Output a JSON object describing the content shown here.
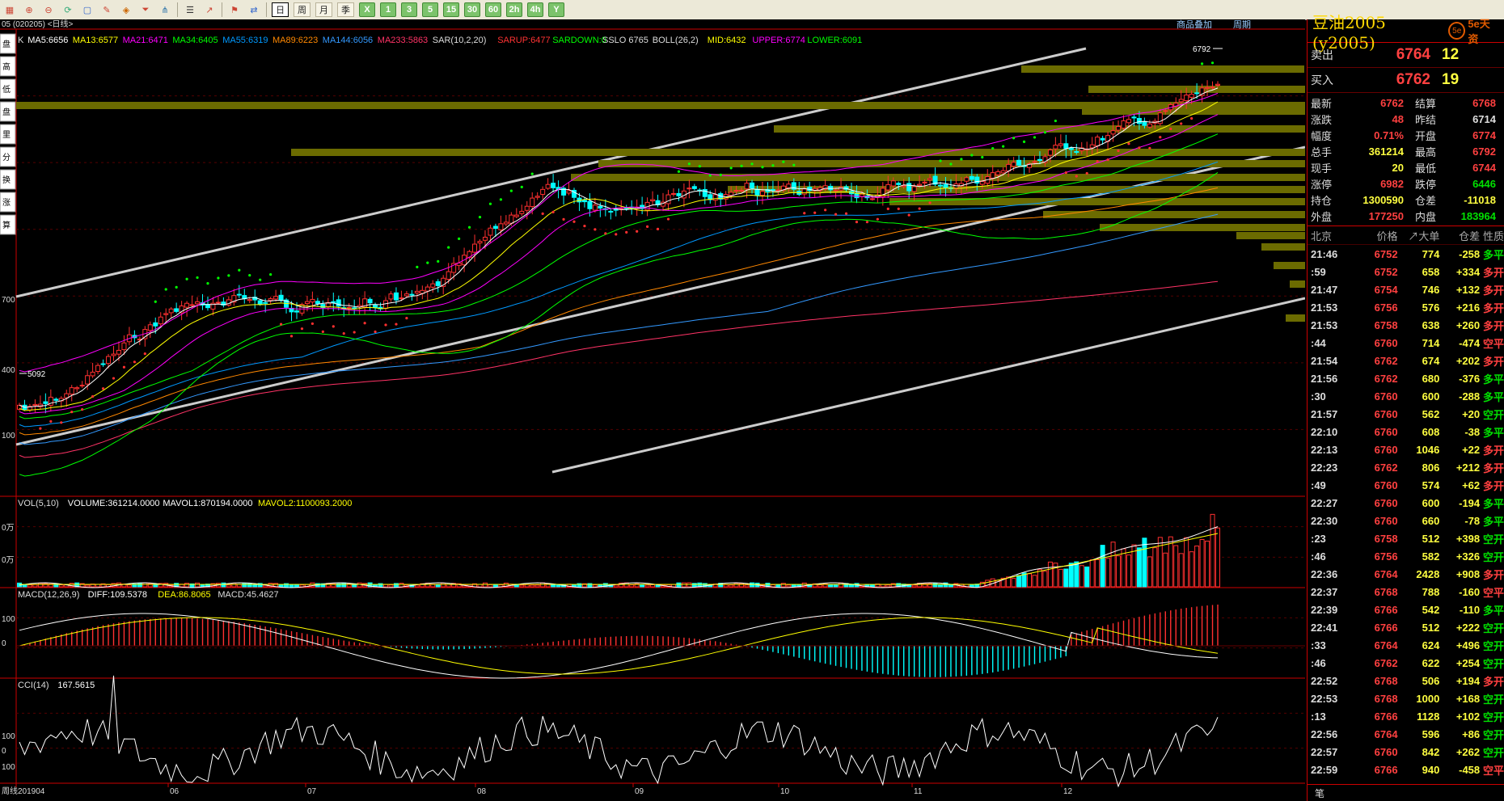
{
  "toolbar": {
    "icons": [
      "chart-grid-icon",
      "zoom-in-icon",
      "zoom-out-icon",
      "refresh-icon",
      "window-icon",
      "pen-icon",
      "paint-bucket-icon",
      "funnel-icon",
      "tree-icon",
      "list-icon",
      "trend-icon",
      "flag-icon",
      "toggle-icon"
    ],
    "periods": [
      "日",
      "周",
      "月",
      "季",
      "X",
      "1",
      "3",
      "5",
      "15",
      "30",
      "60",
      "2h",
      "4h",
      "Y"
    ]
  },
  "chart_header": {
    "path": "05 (020205) <日线>",
    "superimpose_link": "商品叠加",
    "period_link": "周期"
  },
  "left_tabs": [
    "盘",
    "高",
    "低",
    "盘",
    "里",
    "分",
    "换",
    "涨",
    "算"
  ],
  "main_indicator_labels": [
    {
      "text": "K",
      "color": "#dddddd"
    },
    {
      "text": "MA5:6656",
      "color": "#ffffff"
    },
    {
      "text": "MA13:6577",
      "color": "#ffff00"
    },
    {
      "text": "MA21:6471",
      "color": "#ff00ff"
    },
    {
      "text": "MA34:6405",
      "color": "#00ff00"
    },
    {
      "text": "MA55:6319",
      "color": "#0099ff"
    },
    {
      "text": "MA89:6223",
      "color": "#ff8800"
    },
    {
      "text": "MA144:6056",
      "color": "#3399ff"
    },
    {
      "text": "MA233:5863",
      "color": "#ff3366"
    },
    {
      "text": "SAR(10,2,20)",
      "color": "#dddddd"
    },
    {
      "text": "SARUP:6477",
      "color": "#ff3333"
    },
    {
      "text": "SARDOWN:0",
      "color": "#00ff00"
    },
    {
      "text": "SSLO 6765",
      "color": "#dddddd"
    },
    {
      "text": "BOLL(26,2)",
      "color": "#dddddd"
    },
    {
      "text": "MID:6432",
      "color": "#ffff00"
    },
    {
      "text": "UPPER:6774",
      "color": "#ff00ff"
    },
    {
      "text": "LOWER:6091",
      "color": "#00ff00"
    }
  ],
  "price_axis_labels": [
    "700",
    "400",
    "100"
  ],
  "price_markers": {
    "high": "6792",
    "low": "5092"
  },
  "vol_labels": [
    {
      "text": "VOL(5,10)",
      "color": "#dddddd"
    },
    {
      "text": "VOLUME:361214.0000",
      "color": "#ffffff"
    },
    {
      "text": "MAVOL1:870194.0000",
      "color": "#ffffff"
    },
    {
      "text": "MAVOL2:1100093.2000",
      "color": "#ffff00"
    }
  ],
  "vol_axis_labels": [
    "0万",
    "0万"
  ],
  "macd_labels": [
    {
      "text": "MACD(12,26,9)",
      "color": "#dddddd"
    },
    {
      "text": "DIFF:109.5378",
      "color": "#ffffff"
    },
    {
      "text": "DEA:86.8065",
      "color": "#ffff00"
    },
    {
      "text": "MACD:45.4627",
      "color": "#dddddd"
    }
  ],
  "macd_axis_labels": [
    "100",
    "0"
  ],
  "cci_labels": [
    {
      "text": "CCI(14)",
      "color": "#dddddd"
    },
    {
      "text": "167.5615",
      "color": "#ffffff"
    }
  ],
  "cci_axis_labels": [
    "100",
    "0",
    "100"
  ],
  "date_axis": [
    "201904",
    "06",
    "07",
    "08",
    "09",
    "10",
    "11",
    "12"
  ],
  "date_axis_corner": "周线",
  "quote": {
    "title": "豆油2005 (y2005)",
    "logo_mark": "5e",
    "logo_text": "5e天资",
    "ask": {
      "label": "卖出",
      "price": "6764",
      "vol": "12"
    },
    "bid": {
      "label": "买入",
      "price": "6762",
      "vol": "19"
    },
    "stats": [
      {
        "k": "最新",
        "v": "6762",
        "vc": "#ff4040",
        "k2": "结算",
        "v2": "6768",
        "v2c": "#ff4040"
      },
      {
        "k": "涨跌",
        "v": "48",
        "vc": "#ff4040",
        "k2": "昨结",
        "v2": "6714",
        "v2c": "#dddddd"
      },
      {
        "k": "幅度",
        "v": "0.71%",
        "vc": "#ff4040",
        "k2": "开盘",
        "v2": "6774",
        "v2c": "#ff4040"
      },
      {
        "k": "总手",
        "v": "361214",
        "vc": "#ffff40",
        "k2": "最高",
        "v2": "6792",
        "v2c": "#ff4040"
      },
      {
        "k": "现手",
        "v": "20",
        "vc": "#ffff40",
        "k2": "最低",
        "v2": "6744",
        "v2c": "#ff4040"
      },
      {
        "k": "涨停",
        "v": "6982",
        "vc": "#ff4040",
        "k2": "跌停",
        "v2": "6446",
        "v2c": "#00e000"
      },
      {
        "k": "持仓",
        "v": "1300590",
        "vc": "#ffff40",
        "k2": "仓差",
        "v2": "-11018",
        "v2c": "#ffff40"
      },
      {
        "k": "外盘",
        "v": "177250",
        "vc": "#ff4040",
        "k2": "内盘",
        "v2": "183964",
        "v2c": "#00e000"
      }
    ],
    "tick_header": [
      "北京",
      "价格",
      "↗大单",
      "仓差",
      "性质"
    ],
    "ticks": [
      {
        "t": "21:46",
        "p": "6752",
        "v": "774",
        "d": "-258",
        "n": "多平",
        "pc": "#ff4040",
        "dc": "#ffff40",
        "nc": "#00e000"
      },
      {
        "t": ":59",
        "p": "6752",
        "v": "658",
        "d": "+334",
        "n": "多开",
        "pc": "#ff4040",
        "dc": "#ffff40",
        "nc": "#ff4040"
      },
      {
        "t": "21:47",
        "p": "6754",
        "v": "746",
        "d": "+132",
        "n": "多开",
        "pc": "#ff4040",
        "dc": "#ffff40",
        "nc": "#ff4040"
      },
      {
        "t": "21:53",
        "p": "6756",
        "v": "576",
        "d": "+216",
        "n": "多开",
        "pc": "#ff4040",
        "dc": "#ffff40",
        "nc": "#ff4040"
      },
      {
        "t": "21:53",
        "p": "6758",
        "v": "638",
        "d": "+260",
        "n": "多开",
        "pc": "#ff4040",
        "dc": "#ffff40",
        "nc": "#ff4040"
      },
      {
        "t": ":44",
        "p": "6760",
        "v": "714",
        "d": "-474",
        "n": "空平",
        "pc": "#ff4040",
        "dc": "#ffff40",
        "nc": "#ff4040"
      },
      {
        "t": "21:54",
        "p": "6762",
        "v": "674",
        "d": "+202",
        "n": "多开",
        "pc": "#ff4040",
        "dc": "#ffff40",
        "nc": "#ff4040"
      },
      {
        "t": "21:56",
        "p": "6762",
        "v": "680",
        "d": "-376",
        "n": "多平",
        "pc": "#ff4040",
        "dc": "#ffff40",
        "nc": "#00e000"
      },
      {
        "t": ":30",
        "p": "6760",
        "v": "600",
        "d": "-288",
        "n": "多平",
        "pc": "#ff4040",
        "dc": "#ffff40",
        "nc": "#00e000"
      },
      {
        "t": "21:57",
        "p": "6760",
        "v": "562",
        "d": "+20",
        "n": "空开",
        "pc": "#ff4040",
        "dc": "#ffff40",
        "nc": "#00e000"
      },
      {
        "t": "22:10",
        "p": "6760",
        "v": "608",
        "d": "-38",
        "n": "多平",
        "pc": "#ff4040",
        "dc": "#ffff40",
        "nc": "#00e000"
      },
      {
        "t": "22:13",
        "p": "6760",
        "v": "1046",
        "d": "+22",
        "n": "多开",
        "pc": "#ff4040",
        "dc": "#ffff40",
        "nc": "#ff4040"
      },
      {
        "t": "22:23",
        "p": "6762",
        "v": "806",
        "d": "+212",
        "n": "多开",
        "pc": "#ff4040",
        "dc": "#ffff40",
        "nc": "#ff4040"
      },
      {
        "t": ":49",
        "p": "6760",
        "v": "574",
        "d": "+62",
        "n": "多开",
        "pc": "#ff4040",
        "dc": "#ffff40",
        "nc": "#ff4040"
      },
      {
        "t": "22:27",
        "p": "6760",
        "v": "600",
        "d": "-194",
        "n": "多平",
        "pc": "#ff4040",
        "dc": "#ffff40",
        "nc": "#00e000"
      },
      {
        "t": "22:30",
        "p": "6760",
        "v": "660",
        "d": "-78",
        "n": "多平",
        "pc": "#ff4040",
        "dc": "#ffff40",
        "nc": "#00e000"
      },
      {
        "t": ":23",
        "p": "6758",
        "v": "512",
        "d": "+398",
        "n": "空开",
        "pc": "#ff4040",
        "dc": "#ffff40",
        "nc": "#00e000"
      },
      {
        "t": ":46",
        "p": "6756",
        "v": "582",
        "d": "+326",
        "n": "空开",
        "pc": "#ff4040",
        "dc": "#ffff40",
        "nc": "#00e000"
      },
      {
        "t": "22:36",
        "p": "6764",
        "v": "2428",
        "d": "+908",
        "n": "多开",
        "pc": "#ff4040",
        "dc": "#ffff40",
        "nc": "#ff4040"
      },
      {
        "t": "22:37",
        "p": "6768",
        "v": "788",
        "d": "-160",
        "n": "空平",
        "pc": "#ff4040",
        "dc": "#ffff40",
        "nc": "#ff4040"
      },
      {
        "t": "22:39",
        "p": "6766",
        "v": "542",
        "d": "-110",
        "n": "多平",
        "pc": "#ff4040",
        "dc": "#ffff40",
        "nc": "#00e000"
      },
      {
        "t": "22:41",
        "p": "6766",
        "v": "512",
        "d": "+222",
        "n": "空开",
        "pc": "#ff4040",
        "dc": "#ffff40",
        "nc": "#00e000"
      },
      {
        "t": ":33",
        "p": "6764",
        "v": "624",
        "d": "+496",
        "n": "空开",
        "pc": "#ff4040",
        "dc": "#ffff40",
        "nc": "#00e000"
      },
      {
        "t": ":46",
        "p": "6762",
        "v": "622",
        "d": "+254",
        "n": "空开",
        "pc": "#ff4040",
        "dc": "#ffff40",
        "nc": "#00e000"
      },
      {
        "t": "22:52",
        "p": "6768",
        "v": "506",
        "d": "+194",
        "n": "多开",
        "pc": "#ff4040",
        "dc": "#ffff40",
        "nc": "#ff4040"
      },
      {
        "t": "22:53",
        "p": "6768",
        "v": "1000",
        "d": "+168",
        "n": "空开",
        "pc": "#ff4040",
        "dc": "#ffff40",
        "nc": "#00e000"
      },
      {
        "t": ":13",
        "p": "6766",
        "v": "1128",
        "d": "+102",
        "n": "空开",
        "pc": "#ff4040",
        "dc": "#ffff40",
        "nc": "#00e000"
      },
      {
        "t": "22:56",
        "p": "6764",
        "v": "596",
        "d": "+86",
        "n": "空开",
        "pc": "#ff4040",
        "dc": "#ffff40",
        "nc": "#00e000"
      },
      {
        "t": "22:57",
        "p": "6760",
        "v": "842",
        "d": "+262",
        "n": "空开",
        "pc": "#ff4040",
        "dc": "#ffff40",
        "nc": "#00e000"
      },
      {
        "t": "22:59",
        "p": "6766",
        "v": "940",
        "d": "-458",
        "n": "空平",
        "pc": "#ff4040",
        "dc": "#ffff40",
        "nc": "#ff4040"
      }
    ],
    "bottom_tab": "笔"
  }
}
